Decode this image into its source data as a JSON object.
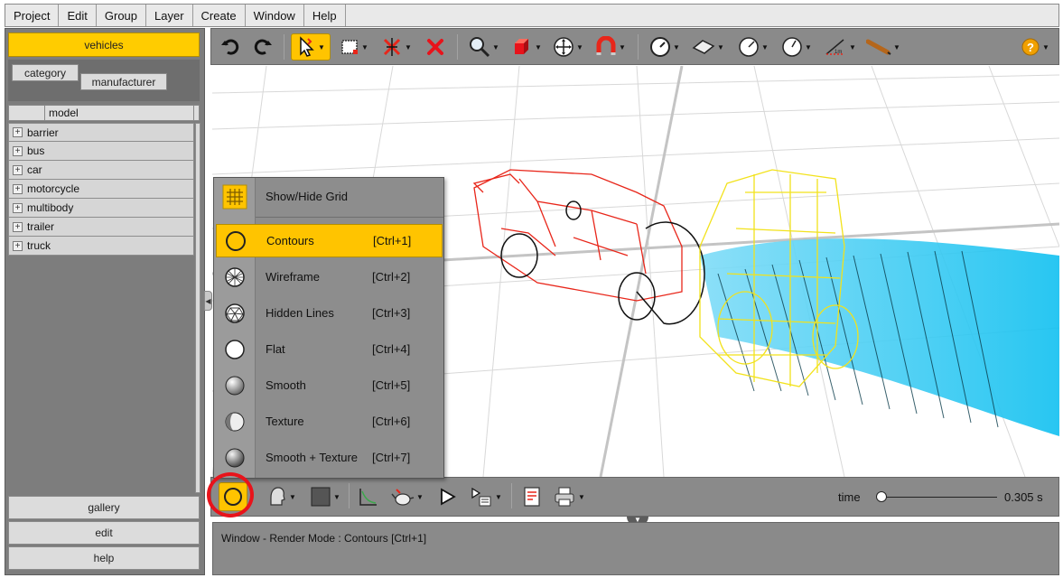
{
  "menubar": {
    "items": [
      "Project",
      "Edit",
      "Group",
      "Layer",
      "Create",
      "Window",
      "Help"
    ]
  },
  "left_panel": {
    "active_tab": "vehicles",
    "filter_tabs": [
      "category",
      "manufacturer"
    ],
    "column_header": "model",
    "tree_items": [
      {
        "label": "barrier",
        "expander": "+"
      },
      {
        "label": "bus",
        "expander": "+"
      },
      {
        "label": "car",
        "expander": "+"
      },
      {
        "label": "motorcycle",
        "expander": "+"
      },
      {
        "label": "multibody",
        "expander": "+"
      },
      {
        "label": "trailer",
        "expander": "+"
      },
      {
        "label": "truck",
        "expander": "+"
      }
    ],
    "bottom_tabs": [
      "gallery",
      "edit",
      "help"
    ]
  },
  "toolbar_top": {
    "icons": [
      "undo-icon",
      "redo-icon",
      "select-arrow-icon",
      "rectangle-select-icon",
      "unlink-icon",
      "delete-icon",
      "zoom-icon",
      "cube-icon",
      "pan-icon",
      "magnet-icon",
      "gauge-icon",
      "plane-icon",
      "speed-dial-icon",
      "dial-icon",
      "measure-1m-icon",
      "pen-tool-icon",
      "help-icon"
    ],
    "measure_label": "1m"
  },
  "render_menu": {
    "items": [
      {
        "label": "Show/Hide Grid",
        "shortcut": "",
        "icon": "grid-icon"
      },
      {
        "label": "Contours",
        "shortcut": "[Ctrl+1]",
        "icon": "contours-icon",
        "selected": true
      },
      {
        "label": "Wireframe",
        "shortcut": "[Ctrl+2]",
        "icon": "wireframe-sphere-icon"
      },
      {
        "label": "Hidden Lines",
        "shortcut": "[Ctrl+3]",
        "icon": "hidden-lines-sphere-icon"
      },
      {
        "label": "Flat",
        "shortcut": "[Ctrl+4]",
        "icon": "flat-sphere-icon"
      },
      {
        "label": "Smooth",
        "shortcut": "[Ctrl+5]",
        "icon": "smooth-sphere-icon"
      },
      {
        "label": "Texture",
        "shortcut": "[Ctrl+6]",
        "icon": "texture-sphere-icon"
      },
      {
        "label": "Smooth + Texture",
        "shortcut": "[Ctrl+7]",
        "icon": "smooth-texture-sphere-icon"
      }
    ]
  },
  "toolbar_bottom": {
    "time_label": "time",
    "time_value": "0.305 s",
    "time_fraction": 0.0
  },
  "statusbar": {
    "text": "Window - Render Mode : Contours [Ctrl+1]"
  },
  "colors": {
    "accent": "#ffc400",
    "panel": "#8a8a8a",
    "highlight_ring": "#e8131b",
    "car_red": "#e8261a",
    "car_yellow": "#f2e21b",
    "trajectory_cyan": "#18c3f0"
  }
}
